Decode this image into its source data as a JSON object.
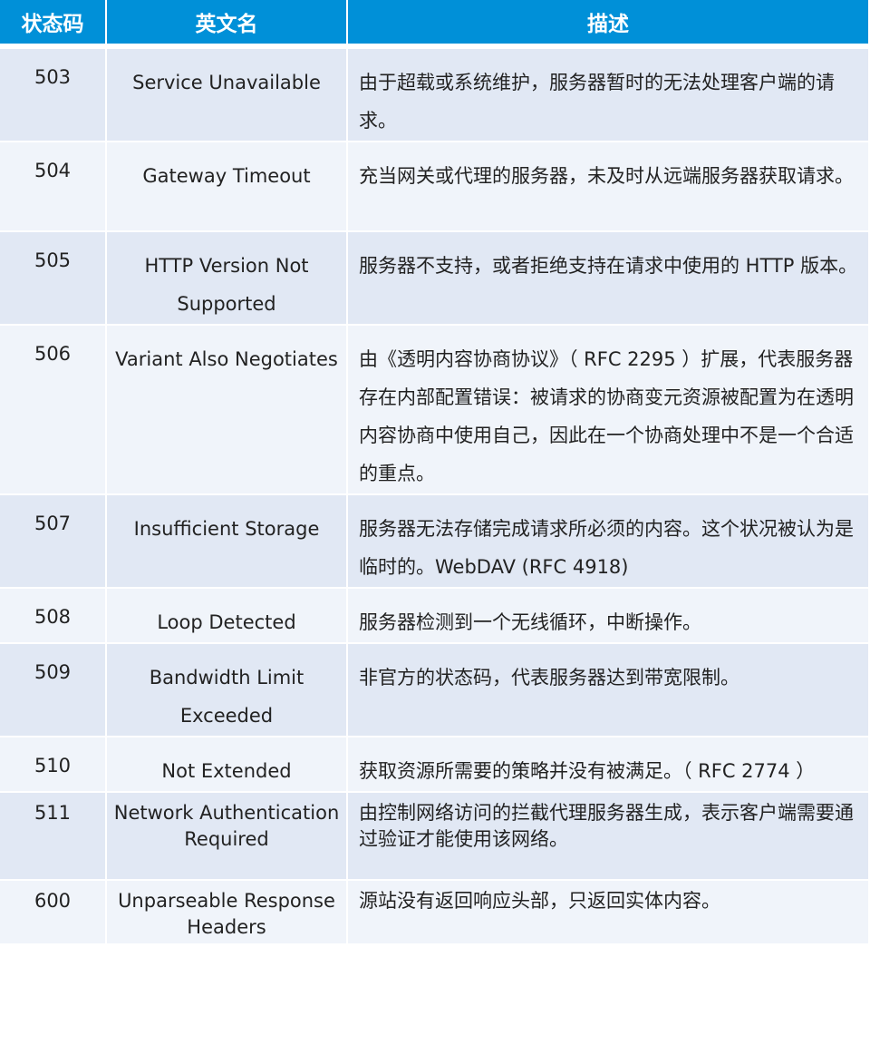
{
  "table": {
    "headers": [
      "状态码",
      "英文名",
      "描述"
    ],
    "rows": [
      {
        "code": "503",
        "name": "Service Unavailable",
        "desc": "由于超载或系统维护，服务器暂时的无法处理客户端的请求。",
        "h": 95
      },
      {
        "code": "504",
        "name": "Gateway Timeout",
        "desc": "充当网关或代理的服务器，未及时从远端服务器获取请求。",
        "h": 96
      },
      {
        "code": "505",
        "name": "HTTP Version Not Supported",
        "desc": "服务器不支持，或者拒绝支持在请求中使用的 HTTP 版本。",
        "h": 95
      },
      {
        "code": "506",
        "name": "Variant Also Negotiates",
        "desc": "由《透明内容协商协议》（ RFC 2295 ）扩展，代表服务器存在内部配置错误：被请求的协商变元资源被配置为在透明内容协商中使用自己，因此在一个协商处理中不是一个合适的重点。",
        "h": 181
      },
      {
        "code": "507",
        "name": "Insufficient Storage",
        "desc": "服务器无法存储完成请求所必须的内容。这个状况被认为是临时的。WebDAV (RFC 4918)",
        "h": 95
      },
      {
        "code": "508",
        "name": "Loop Detected",
        "desc": "服务器检测到一个无线循环，中断操作。",
        "h": 54
      },
      {
        "code": "509",
        "name": "Bandwidth Limit Exceeded",
        "desc": "非官方的状态码，代表服务器达到带宽限制。",
        "h": 95
      },
      {
        "code": "510",
        "name": "Not Extended",
        "desc": "获取资源所需要的策略并没有被满足。（ RFC 2774 ）",
        "h": 53
      },
      {
        "code": "511",
        "name": "Network Authentication Required",
        "desc": "由控制网络访问的拦截代理服务器生成，表示客户端需要通过验证才能使用该网络。",
        "h": 94,
        "tight": true
      },
      {
        "code": "600",
        "name": "Unparseable Response Headers",
        "desc": "源站没有返回响应头部，只返回实体内容。",
        "h": 68,
        "tight": true
      }
    ]
  }
}
